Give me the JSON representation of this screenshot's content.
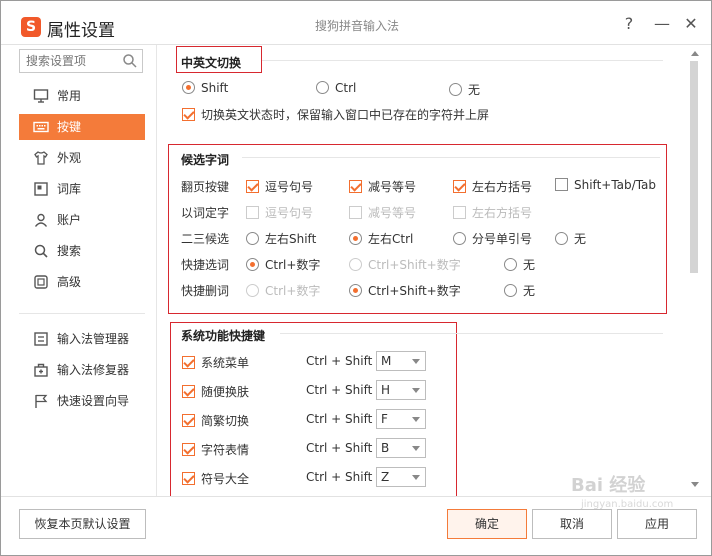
{
  "window": {
    "title": "属性设置",
    "subtitle": "搜狗拼音输入法",
    "logo_letter": "S",
    "help": "?",
    "minimize": "—",
    "close": "✕"
  },
  "sidebar": {
    "search_placeholder": "搜索设置项",
    "items": [
      {
        "label": "常用",
        "icon": "monitor-icon"
      },
      {
        "label": "按键",
        "icon": "keyboard-icon",
        "active": true
      },
      {
        "label": "外观",
        "icon": "shirt-icon"
      },
      {
        "label": "词库",
        "icon": "book-icon"
      },
      {
        "label": "账户",
        "icon": "user-icon"
      },
      {
        "label": "搜索",
        "icon": "search-icon"
      },
      {
        "label": "高级",
        "icon": "advanced-icon"
      }
    ],
    "tools": [
      {
        "label": "输入法管理器",
        "icon": "manager-icon"
      },
      {
        "label": "输入法修复器",
        "icon": "repair-icon"
      },
      {
        "label": "快速设置向导",
        "icon": "flag-icon"
      }
    ]
  },
  "section_switch": {
    "title": "中英文切换",
    "options": [
      "Shift",
      "Ctrl",
      "无"
    ],
    "selected": "Shift",
    "keep_checkbox": "切换英文状态时，保留输入窗口中已存在的字符并上屏"
  },
  "section_candidates": {
    "title": "候选字词",
    "page_keys": {
      "label": "翻页按键",
      "options": [
        "逗号句号",
        "减号等号",
        "左右方括号",
        "Shift+Tab/Tab"
      ]
    },
    "fix_word": {
      "label": "以词定字",
      "options": [
        "逗号句号",
        "减号等号",
        "左右方括号"
      ]
    },
    "second_third": {
      "label": "二三候选",
      "options": [
        "左右Shift",
        "左右Ctrl",
        "分号单引号",
        "无"
      ],
      "selected": "左右Ctrl"
    },
    "quick_select": {
      "label": "快捷选词",
      "options": [
        "Ctrl+数字",
        "Ctrl+Shift+数字",
        "无"
      ],
      "selected": "Ctrl+数字"
    },
    "quick_delete": {
      "label": "快捷删词",
      "options": [
        "Ctrl+数字",
        "Ctrl+Shift+数字",
        "无"
      ],
      "selected": "Ctrl+Shift+数字"
    }
  },
  "section_shortcuts": {
    "title": "系统功能快捷键",
    "prefix": "Ctrl + Shift +",
    "rows": [
      {
        "label": "系统菜单",
        "key": "M"
      },
      {
        "label": "随便换肤",
        "key": "H"
      },
      {
        "label": "简繁切换",
        "key": "F"
      },
      {
        "label": "字符表情",
        "key": "B"
      },
      {
        "label": "符号大全",
        "key": "Z"
      }
    ]
  },
  "buttons": {
    "restore": "恢复本页默认设置",
    "ok": "确定",
    "cancel": "取消",
    "apply": "应用"
  },
  "watermark": {
    "text": "Bai 经验",
    "sub": "jingyan.baidu.com"
  },
  "colors": {
    "accent": "#f47b3a",
    "highlight_box": "#d7282f"
  }
}
